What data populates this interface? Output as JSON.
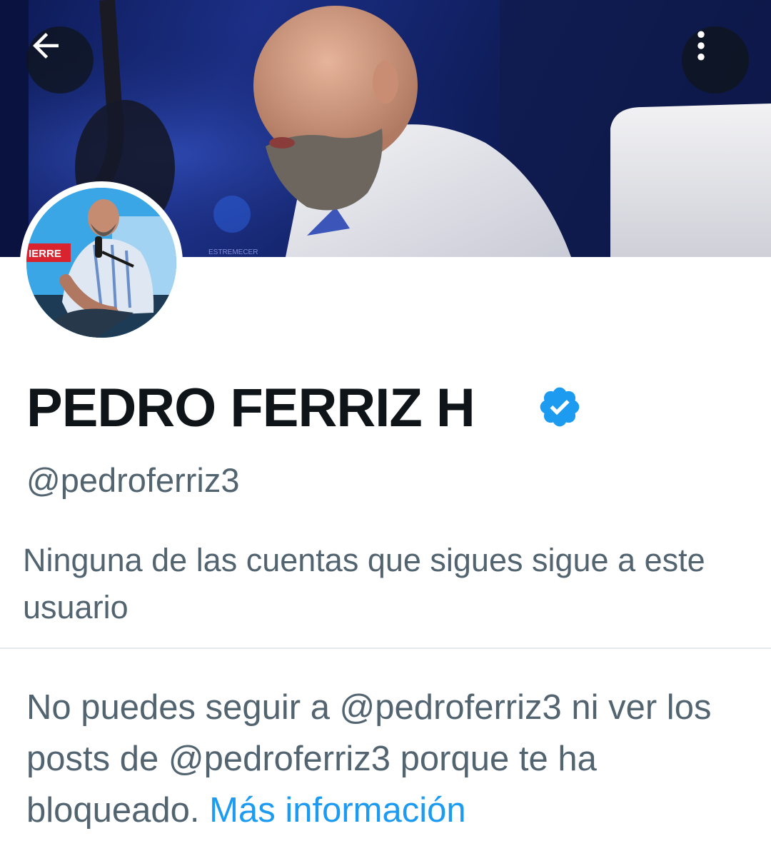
{
  "header": {
    "back_icon": "arrow-left-icon",
    "more_icon": "more-vertical-icon"
  },
  "banner": {
    "sign_text": "IERRE"
  },
  "profile": {
    "display_name": "PEDRO FERRIZ H",
    "verified": true,
    "handle": "@pedroferriz3",
    "followers_you_know": "Ninguna de las cuentas que sigues sigue a este usuario"
  },
  "blocked": {
    "message": "No puedes seguir a @pedroferriz3 ni ver los posts de @pedroferriz3 porque te ha bloqueado.",
    "link_label": "Más información"
  },
  "colors": {
    "text_primary": "#0f1419",
    "text_secondary": "#536471",
    "link": "#1d9bf0",
    "verified_badge": "#1d9bf0",
    "divider": "#e6e9ec"
  }
}
